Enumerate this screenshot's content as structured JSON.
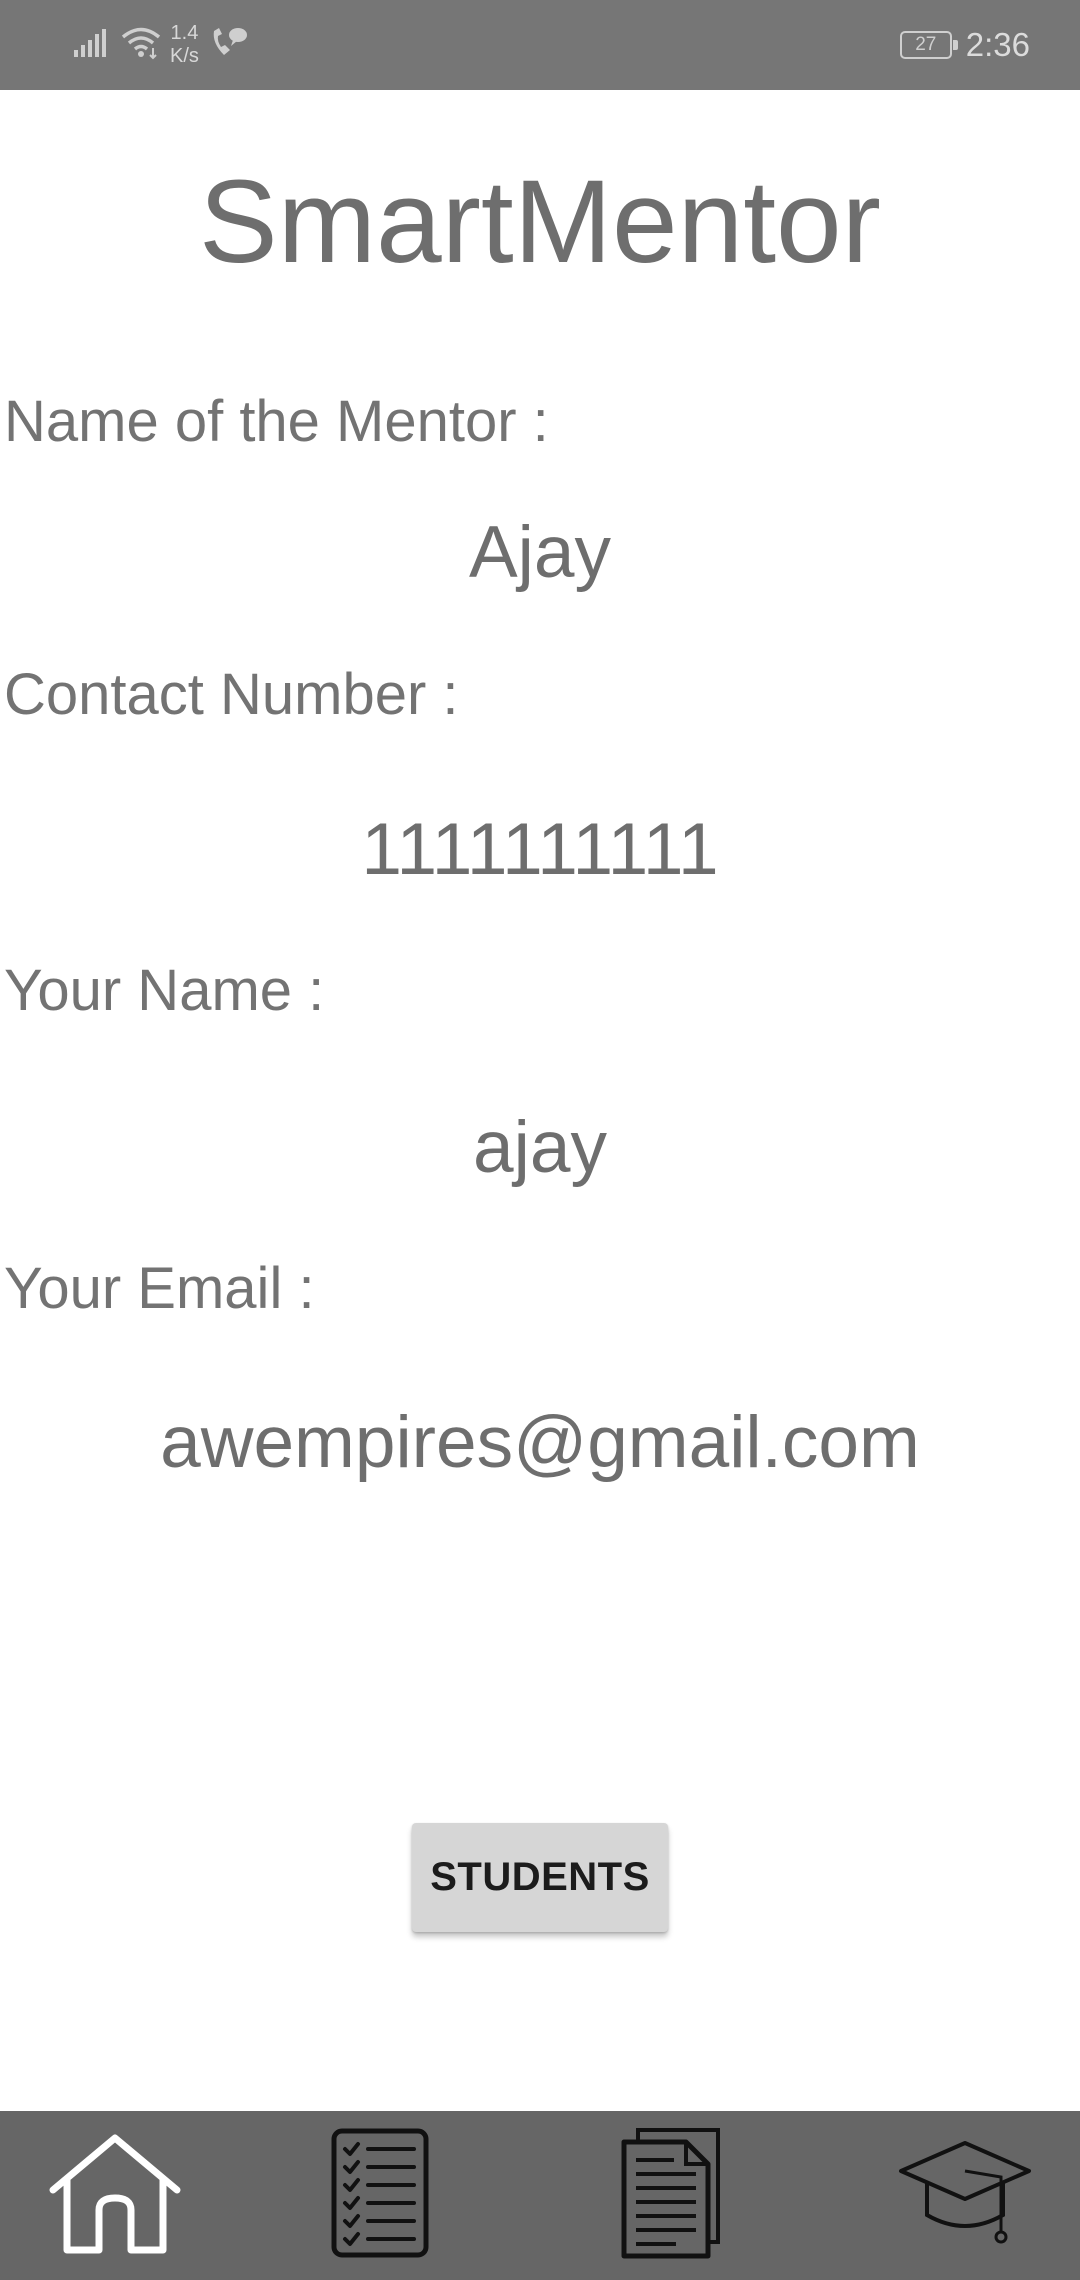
{
  "status_bar": {
    "network_speed_value": "1.4",
    "network_speed_unit": "K/s",
    "battery_level": "27",
    "time": "2:36"
  },
  "app": {
    "title": "SmartMentor"
  },
  "profile": {
    "mentor_name_label": "Name of the Mentor :",
    "mentor_name_value": "Ajay",
    "contact_label": "Contact Number :",
    "contact_value": "1111111111",
    "your_name_label": "Your Name :",
    "your_name_value": "ajay",
    "your_email_label": "Your Email :",
    "your_email_value": "awempires@gmail.com"
  },
  "actions": {
    "students_button_label": "STUDENTS"
  },
  "bottom_nav": {
    "items": [
      {
        "icon": "home-icon"
      },
      {
        "icon": "checklist-icon"
      },
      {
        "icon": "documents-icon"
      },
      {
        "icon": "graduation-cap-icon"
      }
    ]
  },
  "colors": {
    "status_bar_bg": "#767676",
    "bottom_nav_bg": "#666666",
    "text": "#707070",
    "button_bg": "#d6d6d6"
  }
}
